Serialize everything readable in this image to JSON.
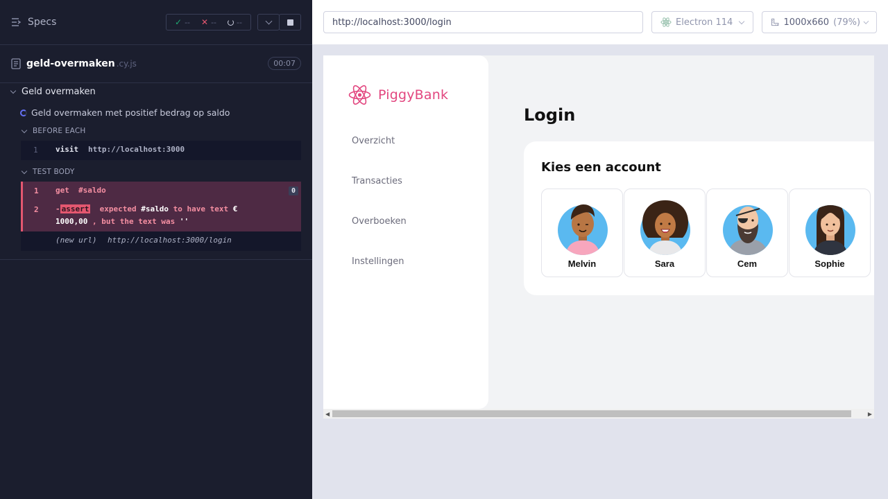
{
  "reporter": {
    "specs_label": "Specs",
    "stats": {
      "passed": "--",
      "failed": "--",
      "pending": "--"
    },
    "file": {
      "name": "geld-overmaken",
      "ext": ".cy.js",
      "duration": "00:07"
    },
    "suite_title": "Geld overmaken",
    "test_title": "Geld overmaken met positief bedrag op saldo",
    "before_each_label": "BEFORE EACH",
    "test_body_label": "TEST BODY",
    "before_each_commands": [
      {
        "num": "1",
        "name": "visit",
        "arg": "http://localhost:3000"
      }
    ],
    "test_body_commands": [
      {
        "num": "1",
        "name": "get",
        "arg": "#saldo",
        "badge": "0"
      },
      {
        "num": "2",
        "prefix": "-",
        "tag": "assert",
        "t1": "expected",
        "t2": "#saldo",
        "t3": "to have text",
        "t4": "€",
        "t5": "1000,00",
        "t6": ", but the text was",
        "t7": "''"
      }
    ],
    "new_url": {
      "label": "(new url)",
      "value": "http://localhost:3000/login"
    }
  },
  "aut": {
    "url": "http://localhost:3000/login",
    "browser": "Electron 114",
    "viewport": "1000x660",
    "zoom": "(79%)"
  },
  "app": {
    "brand": "PiggyBank",
    "nav": [
      "Overzicht",
      "Transacties",
      "Overboeken",
      "Instellingen"
    ],
    "page_title": "Login",
    "card_title": "Kies een account",
    "accounts": [
      "Melvin",
      "Sara",
      "Cem",
      "Sophie"
    ]
  },
  "colors": {
    "reporter_bg": "#1b1e2e",
    "fail_bg": "#4e2a44",
    "fail_text": "#f58fa2",
    "brand_pink": "#e2467f",
    "avatar_bg": "#5ab9f0"
  },
  "icons": {
    "specs": "list-arrow-icon",
    "passed": "check-icon",
    "failed": "x-icon",
    "pending": "circle-loading-icon",
    "file": "document-icon",
    "browser": "electron-icon",
    "viewport": "ruler-icon",
    "logo": "atom-icon"
  }
}
